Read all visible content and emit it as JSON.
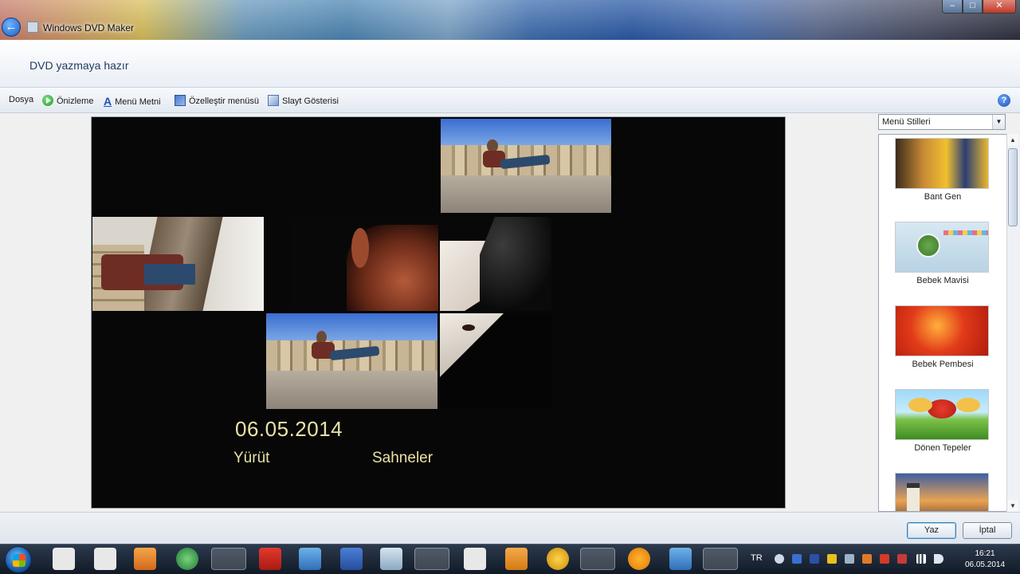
{
  "window": {
    "app_title": "Windows DVD Maker"
  },
  "header": {
    "title": "DVD yazmaya hazır"
  },
  "toolbar": {
    "file": "Dosya",
    "preview": "Önizleme",
    "menu_text": "Menü Metni",
    "customize_menu": "Özelleştir menüsü",
    "slideshow": "Slayt Gösterisi"
  },
  "preview": {
    "date": "06.05.2014",
    "play": "Yürüt",
    "scenes": "Sahneler"
  },
  "styles": {
    "dropdown": "Menü Stilleri",
    "items": [
      {
        "label": "Bant Gen"
      },
      {
        "label": "Bebek Mavisi"
      },
      {
        "label": "Bebek Pembesi"
      },
      {
        "label": "Dönen Tepeler"
      }
    ]
  },
  "buttons": {
    "write": "Yaz",
    "cancel": "İptal"
  },
  "taskbar": {
    "lang": "TR",
    "time": "16:21",
    "date": "06.05.2014"
  },
  "icons": {
    "back": "back-arrow-icon",
    "preview": "play-icon",
    "menu_text": "text-icon",
    "customize": "customize-icon",
    "slideshow": "slideshow-icon",
    "help": "help-icon"
  },
  "colors": {
    "preview_text": "#e9e2a6",
    "preview_bg": "#070707",
    "accent": "#1f5fbf"
  }
}
